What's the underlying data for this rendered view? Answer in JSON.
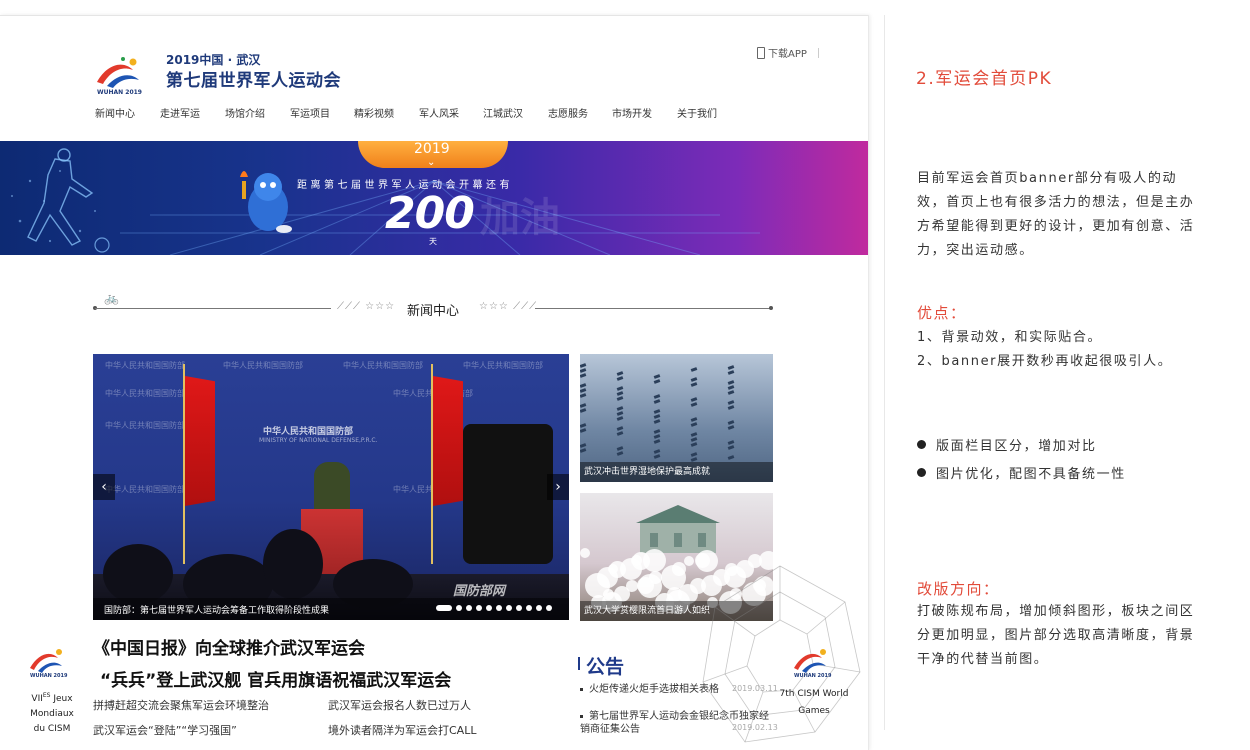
{
  "site": {
    "logo_year": "2019中国 · 武汉",
    "logo_title": "第七届世界军人运动会",
    "logo_small_text": "WUHAN 2019",
    "download_label": "下载APP",
    "nav": [
      "新闻中心",
      "走进军运",
      "场馆介绍",
      "军运项目",
      "精彩视频",
      "军人风采",
      "江城武汉",
      "志愿服务",
      "市场开发",
      "关于我们"
    ],
    "banner": {
      "year": "2019",
      "headline": "距离第七届世界军人运动会开幕还有",
      "days": "200",
      "unit": "天"
    },
    "section_title": "新闻中心",
    "hero": {
      "caption": "国防部：第七届世界军人运动会筹备工作取得阶段性成果",
      "watermark": "国防部网",
      "wall_text": "中华人民共和国国防部",
      "wall_subtext": "MINISTRY OF NATIONAL DEFENSE,P.R.C.",
      "slide_count": 11,
      "active_slide": 1
    },
    "thumbs": [
      {
        "caption": "武汉冲击世界湿地保护最高成就"
      },
      {
        "caption": "武汉大学赏樱限流首日游人如织"
      }
    ],
    "headlines": [
      "《中国日报》向全球推介武汉军运会",
      "“兵兵”登上武汉舰 官兵用旗语祝福武汉军运会"
    ],
    "news_items": [
      "拼搏赶超交流会聚焦军运会环境整治",
      "武汉军运会报名人数已过万人",
      "武汉军运会“登陆”“学习强国”",
      "境外读者隔洋为军运会打CALL"
    ],
    "notices": {
      "title": "公告",
      "items": [
        {
          "text": "火炬传递火炬手选拔相关表格",
          "date": "2019.03.11"
        },
        {
          "text": "第七届世界军人运动会金银纪念币独家经",
          "text2": "销商征集公告",
          "date": "2019.02.13"
        }
      ]
    },
    "badge_left": {
      "line1": "VII",
      "sup": "ES",
      "line1b": " Jeux Mondiaux",
      "line2": "du CISM"
    },
    "badge_right": {
      "line1": "7th CISM World",
      "line2": "Games"
    }
  },
  "review": {
    "title": "2.军运会首页PK",
    "intro": "目前军运会首页banner部分有吸人的动效，首页上也有很多活力的想法，但是主办方希望能得到更好的设计，更加有创意、活力，突出运动感。",
    "pros_title": "优点：",
    "pros": [
      "1、背景动效，和实际贴合。",
      "2、banner展开数秒再收起很吸引人。"
    ],
    "issues": [
      "版面栏目区分，增加对比",
      "图片优化，配图不具备统一性"
    ],
    "direction_title": "改版方向：",
    "direction": "打破陈规布局，增加倾斜图形，板块之间区分更加明显，图片部分选取高清晰度，背景干净的代替当前图。"
  },
  "colors": {
    "accent_red": "#e24b3a",
    "brand_blue": "#1f3a7a",
    "banner_orange": "#f39a2e"
  }
}
